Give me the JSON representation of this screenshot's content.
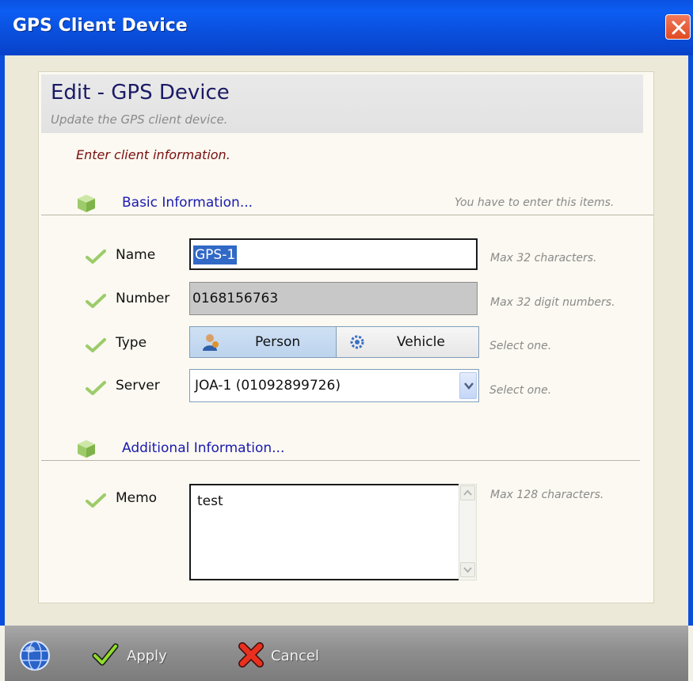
{
  "window": {
    "title": "GPS Client Device"
  },
  "header": {
    "title": "Edit - GPS Device",
    "subtitle": "Update the GPS client device.",
    "instruction": "Enter client information."
  },
  "sections": {
    "basic": {
      "label": "Basic Information...",
      "hint": "You have to enter this items."
    },
    "additional": {
      "label": "Additional Information..."
    }
  },
  "fields": {
    "name": {
      "label": "Name",
      "value": "GPS-1",
      "hint": "Max 32 characters."
    },
    "number": {
      "label": "Number",
      "value": "0168156763",
      "hint": "Max 32 digit numbers."
    },
    "type": {
      "label": "Type",
      "options": [
        "Person",
        "Vehicle"
      ],
      "selected": "Person",
      "hint": "Select one."
    },
    "server": {
      "label": "Server",
      "value": "JOA-1 (01092899726)",
      "hint": "Select one."
    },
    "memo": {
      "label": "Memo",
      "value": "test",
      "hint": "Max 128 characters."
    }
  },
  "footer": {
    "apply_label": "Apply",
    "cancel_label": "Cancel"
  },
  "colors": {
    "titlebar": "#0a4fdc",
    "section_label": "#1a1ab0",
    "instruction": "#7a1010",
    "selection": "#3169c6"
  },
  "icons": {
    "close": "close-icon",
    "section": "cube-icon",
    "field": "checkmark-icon",
    "person": "person-icon",
    "vehicle": "gear-icon",
    "dropdown": "chevron-down-icon",
    "app": "globe-icon",
    "apply": "checkmark-icon",
    "cancel": "x-icon"
  }
}
